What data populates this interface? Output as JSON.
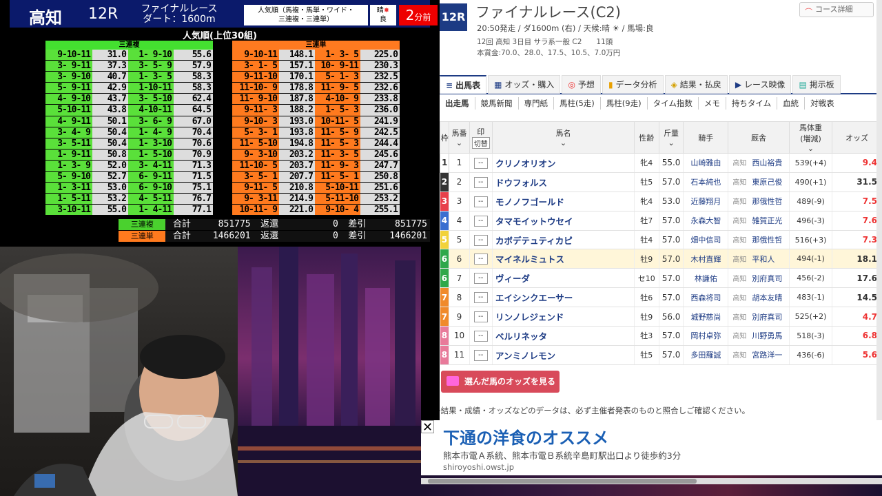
{
  "tv": {
    "venue": "高知",
    "race_no": "12R",
    "race_name_1": "ファイナルレース",
    "race_name_2": "ダート：1600m",
    "kind_1": "人気順（馬複・馬単・ワイド・",
    "kind_2": "三連複・三連単）",
    "weather": "晴",
    "track": "良",
    "minutes": "2",
    "minutes_unit": "分前",
    "rank_title": "人気順(上位30組)",
    "sanrenpuku_label": "三連複",
    "sanrentan_label": "三連単",
    "sanrenpuku": [
      [
        "9-10-11",
        "31.0",
        "1- 9-10",
        "55.6"
      ],
      [
        "3- 9-11",
        "37.3",
        "3- 5- 9",
        "57.9"
      ],
      [
        "3- 9-10",
        "40.7",
        "1- 3- 5",
        "58.3"
      ],
      [
        "5- 9-11",
        "42.9",
        "1-10-11",
        "58.3"
      ],
      [
        "4- 9-10",
        "43.7",
        "3- 5-10",
        "62.4"
      ],
      [
        "5-10-11",
        "43.8",
        "4-10-11",
        "64.5"
      ],
      [
        "4- 9-11",
        "50.1",
        "3- 6- 9",
        "67.0"
      ],
      [
        "3- 4- 9",
        "50.4",
        "1- 4- 9",
        "70.4"
      ],
      [
        "3- 5-11",
        "50.4",
        "1- 3-10",
        "70.6"
      ],
      [
        "1- 9-11",
        "50.8",
        "1- 5-10",
        "70.9"
      ],
      [
        "1- 3- 9",
        "52.0",
        "3- 4-11",
        "71.3"
      ],
      [
        "5- 9-10",
        "52.7",
        "6- 9-11",
        "71.5"
      ],
      [
        "1- 3-11",
        "53.0",
        "6- 9-10",
        "75.1"
      ],
      [
        "1- 5-11",
        "53.2",
        "4- 5-11",
        "76.7"
      ],
      [
        "3-10-11",
        "55.0",
        "1- 4-11",
        "77.1"
      ]
    ],
    "sanrentan": [
      [
        "9-10-11",
        "148.1",
        "1- 3- 5",
        "225.0"
      ],
      [
        "3- 1- 5",
        "157.1",
        "10- 9-11",
        "230.3"
      ],
      [
        "9-11-10",
        "170.1",
        "5- 1- 3",
        "232.5"
      ],
      [
        "11-10- 9",
        "178.8",
        "11- 9- 5",
        "232.6"
      ],
      [
        "11- 9-10",
        "187.8",
        "4-10- 9",
        "233.8"
      ],
      [
        "9-11- 3",
        "188.2",
        "1- 5- 3",
        "236.0"
      ],
      [
        "9-10- 3",
        "193.0",
        "10-11- 5",
        "241.9"
      ],
      [
        "5- 3- 1",
        "193.8",
        "11- 5- 9",
        "242.5"
      ],
      [
        "11- 5-10",
        "194.8",
        "11- 5- 3",
        "244.4"
      ],
      [
        "9- 3-10",
        "203.2",
        "11- 3- 5",
        "245.6"
      ],
      [
        "11-10- 5",
        "203.7",
        "11- 9- 3",
        "247.7"
      ],
      [
        "3- 5- 1",
        "207.7",
        "11- 5- 1",
        "250.8"
      ],
      [
        "9-11- 5",
        "210.8",
        "5-10-11",
        "251.6"
      ],
      [
        "9- 3-11",
        "214.9",
        "5-11-10",
        "253.2"
      ],
      [
        "10-11- 9",
        "221.0",
        "9-10- 4",
        "255.1"
      ]
    ],
    "totals": [
      {
        "name": "三連複",
        "sum_label": "合計",
        "sum": "851775",
        "ret_label": "返還",
        "ret": "0",
        "net_label": "差引",
        "net": "851775"
      },
      {
        "name": "三連単",
        "sum_label": "合計",
        "sum": "1466201",
        "ret_label": "返還",
        "ret": "0",
        "net_label": "差引",
        "net": "1466201"
      }
    ]
  },
  "web": {
    "race_badge": "12R",
    "race_title": "ファイナルレース(C2)",
    "info1": "20:50発走 / ダ1600m (右) / 天候:晴 ☀ / 馬場:良",
    "info2": "12回 高知 3日目 サラ系一般 C2　　11頭",
    "info3": "本賞金:70.0、28.0、17.5、10.5、7.0万円",
    "course_btn": "コース詳細",
    "tabs": [
      {
        "icon": "≡",
        "label": "出馬表"
      },
      {
        "icon": "▦",
        "label": "オッズ・購入"
      },
      {
        "icon": "◎",
        "label": "予想"
      },
      {
        "icon": "▮",
        "label": "データ分析"
      },
      {
        "icon": "◈",
        "label": "結果・払戻"
      },
      {
        "icon": "▶",
        "label": "レース映像"
      },
      {
        "icon": "▤",
        "label": "掲示板"
      }
    ],
    "subtabs": [
      "出走馬",
      "競馬新聞",
      "専門紙",
      "馬柱(5走)",
      "馬柱(9走)",
      "タイム指数",
      "メモ",
      "持ちタイム",
      "血統",
      "対戦表"
    ],
    "headers": {
      "waku": "枠",
      "umaban": "馬番",
      "mark": "印",
      "mark_sub": "切替",
      "name": "馬名",
      "sex": "性齢",
      "kin": "斤量",
      "jockey": "騎手",
      "trainer": "厩舎",
      "weight": "馬体重",
      "weight_sub": "(増減)",
      "odds": "オッズ"
    },
    "horses": [
      {
        "waku": "1",
        "no": "1",
        "mark": "--",
        "name": "クリノオリオン",
        "sex": "牝4",
        "kin": "55.0",
        "jockey": "山崎雅由",
        "reg": "高知",
        "trainer": "西山裕貴",
        "weight": "539(+4)",
        "odds": "9.4",
        "wcolor": "#ffffff",
        "wtext": "#333333",
        "hot": true
      },
      {
        "waku": "2",
        "no": "2",
        "mark": "--",
        "name": "ドウフォルス",
        "sex": "牡5",
        "kin": "57.0",
        "jockey": "石本純也",
        "reg": "高知",
        "trainer": "東原己俊",
        "weight": "490(+1)",
        "odds": "31.5",
        "wcolor": "#333333",
        "wtext": "#ffffff",
        "hot": false
      },
      {
        "waku": "3",
        "no": "3",
        "mark": "--",
        "name": "モノノフゴールド",
        "sex": "牝4",
        "kin": "53.0",
        "jockey": "近藤翔月",
        "reg": "高知",
        "trainer": "那俄性哲",
        "weight": "489(-9)",
        "odds": "7.5",
        "wcolor": "#e8404a",
        "wtext": "#ffffff",
        "hot": true
      },
      {
        "waku": "4",
        "no": "4",
        "mark": "--",
        "name": "タマモイットウセイ",
        "sex": "牡7",
        "kin": "57.0",
        "jockey": "永森大智",
        "reg": "高知",
        "trainer": "雑賀正光",
        "weight": "496(-3)",
        "odds": "7.6",
        "wcolor": "#3a6fd0",
        "wtext": "#ffffff",
        "hot": true
      },
      {
        "waku": "5",
        "no": "5",
        "mark": "--",
        "name": "カボデテュティカピ",
        "sex": "牡4",
        "kin": "57.0",
        "jockey": "畑中信司",
        "reg": "高知",
        "trainer": "那俄性哲",
        "weight": "516(+3)",
        "odds": "7.3",
        "wcolor": "#f2d23a",
        "wtext": "#ffffff",
        "hot": true
      },
      {
        "waku": "6",
        "no": "6",
        "mark": "--",
        "name": "マイネルミュトス",
        "sex": "牡9",
        "kin": "57.0",
        "jockey": "木村直輝",
        "reg": "高知",
        "trainer": "平和人",
        "weight": "494(-1)",
        "odds": "18.1",
        "wcolor": "#2fa84a",
        "wtext": "#ffffff",
        "hot": false
      },
      {
        "waku": "6",
        "no": "7",
        "mark": "--",
        "name": "ヴィーダ",
        "sex": "セ10",
        "kin": "57.0",
        "jockey": "林謙佑",
        "reg": "高知",
        "trainer": "別府真司",
        "weight": "456(-2)",
        "odds": "17.6",
        "wcolor": "#2fa84a",
        "wtext": "#ffffff",
        "hot": false
      },
      {
        "waku": "7",
        "no": "8",
        "mark": "--",
        "name": "エイシンクエーサー",
        "sex": "牡6",
        "kin": "57.0",
        "jockey": "西森将司",
        "reg": "高知",
        "trainer": "胡本友晴",
        "weight": "483(-1)",
        "odds": "14.5",
        "wcolor": "#f08a2a",
        "wtext": "#ffffff",
        "hot": false
      },
      {
        "waku": "7",
        "no": "9",
        "mark": "--",
        "name": "リンノレジェンド",
        "sex": "牡9",
        "kin": "56.0",
        "jockey": "城野慈尚",
        "reg": "高知",
        "trainer": "別府真司",
        "weight": "525(+2)",
        "odds": "4.7",
        "wcolor": "#f08a2a",
        "wtext": "#ffffff",
        "hot": true
      },
      {
        "waku": "8",
        "no": "10",
        "mark": "--",
        "name": "ベルリネッタ",
        "sex": "牡3",
        "kin": "57.0",
        "jockey": "岡村卓弥",
        "reg": "高知",
        "trainer": "川野勇馬",
        "weight": "518(-3)",
        "odds": "6.8",
        "wcolor": "#e87a9a",
        "wtext": "#ffffff",
        "hot": true
      },
      {
        "waku": "8",
        "no": "11",
        "mark": "--",
        "name": "アンミノレモン",
        "sex": "牡5",
        "kin": "57.0",
        "jockey": "多田羅誠",
        "reg": "高知",
        "trainer": "宮路洋一",
        "weight": "436(-6)",
        "odds": "5.6",
        "wcolor": "#e87a9a",
        "wtext": "#ffffff",
        "hot": true
      }
    ],
    "vote_btn": "選んだ馬のオッズを見る",
    "note": "※結果・成績・オッズなどのデータは、必ず主催者発表のものと照合しご確認ください。"
  },
  "ad": {
    "close": "✕",
    "title": "下通の洋食のオススメ",
    "desc": "熊本市電Ａ系統、熊本市電Ｂ系統辛島町駅出口より徒歩約3分",
    "url": "shiroyoshi.owst.jp"
  },
  "colors": {
    "navy": "#1d3b84",
    "green": "#5ae03a",
    "orange": "#ff7a1e",
    "hot": "#e33333"
  }
}
